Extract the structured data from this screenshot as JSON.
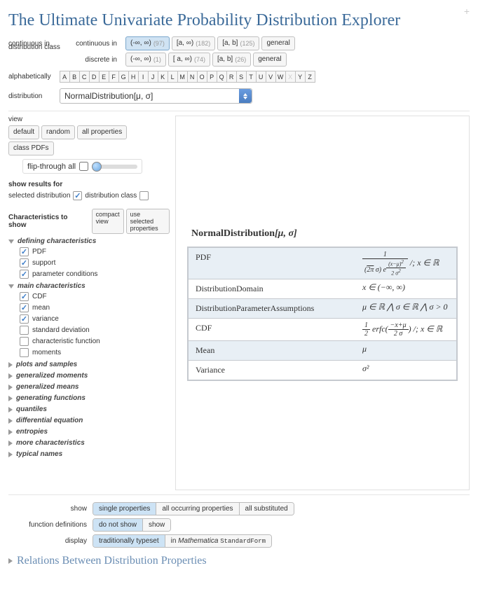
{
  "title": "The Ultimate Univariate Probability Distribution Explorer",
  "plus_icon": "+",
  "distribution_class_label": "distribution class",
  "continuous_label": "continuous in",
  "discrete_label": "discrete in",
  "continuous_ranges": [
    {
      "label": "(-∞, ∞)",
      "count": "(97)",
      "selected": true
    },
    {
      "label": "[a, ∞)",
      "count": "(182)",
      "selected": false
    },
    {
      "label": "[a, b]",
      "count": "(125)",
      "selected": false
    },
    {
      "label": "general",
      "count": "",
      "selected": false
    }
  ],
  "discrete_ranges": [
    {
      "label": "(-∞, ∞)",
      "count": "(1)",
      "selected": false
    },
    {
      "label": "[ a, ∞)",
      "count": "(74)",
      "selected": false
    },
    {
      "label": "[a, b]",
      "count": "(26)",
      "selected": false
    },
    {
      "label": "general",
      "count": "",
      "selected": false
    }
  ],
  "alphabetically_label": "alphabetically",
  "alphabet": [
    "A",
    "B",
    "C",
    "D",
    "E",
    "F",
    "G",
    "H",
    "I",
    "J",
    "K",
    "L",
    "M",
    "N",
    "O",
    "P",
    "Q",
    "R",
    "S",
    "T",
    "U",
    "V",
    "W",
    "X",
    "Y",
    "Z"
  ],
  "alphabet_disabled": [
    "X"
  ],
  "distribution_label": "distribution",
  "distribution_selected": "NormalDistribution[μ, σ]",
  "view_label": "view",
  "view_options": [
    "default",
    "random",
    "all properties",
    "class PDFs"
  ],
  "flip_label": "flip-through all",
  "show_results_for": "show results for",
  "selected_distribution_label": "selected distribution",
  "distribution_class_check_label": "distribution class",
  "characteristics_label": "Characteristics to show",
  "char_buttons": {
    "compact": "compact\nview",
    "use_selected": "use selected\nproperties"
  },
  "categories": [
    {
      "name": "defining characteristics",
      "open": true,
      "items": [
        {
          "label": "PDF",
          "checked": true
        },
        {
          "label": "support",
          "checked": true
        },
        {
          "label": "parameter conditions",
          "checked": true
        }
      ]
    },
    {
      "name": "main characteristics",
      "open": true,
      "items": [
        {
          "label": "CDF",
          "checked": true
        },
        {
          "label": "mean",
          "checked": true
        },
        {
          "label": "variance",
          "checked": true
        },
        {
          "label": "standard deviation",
          "checked": false
        },
        {
          "label": "characteristic function",
          "checked": false
        },
        {
          "label": "moments",
          "checked": false
        }
      ]
    },
    {
      "name": "plots and samples",
      "open": false
    },
    {
      "name": "generalized moments",
      "open": false
    },
    {
      "name": "generalized means",
      "open": false
    },
    {
      "name": "generating functions",
      "open": false
    },
    {
      "name": "quantiles",
      "open": false
    },
    {
      "name": "differential equation",
      "open": false
    },
    {
      "name": "entropies",
      "open": false
    },
    {
      "name": "more characteristics",
      "open": false
    },
    {
      "name": "typical names",
      "open": false
    }
  ],
  "result": {
    "title_dist": "NormalDistribution",
    "title_params": "[μ, σ]",
    "rows": [
      {
        "label": "PDF",
        "highlight": true,
        "value_html": "pdf"
      },
      {
        "label": "DistributionDomain",
        "highlight": false,
        "value": "x ∈ (−∞, ∞)"
      },
      {
        "label": "DistributionParameterAssumptions",
        "highlight": true,
        "value": "μ ∈ ℝ ⋀ σ ∈ ℝ ⋀ σ > 0"
      },
      {
        "label": "CDF",
        "highlight": false,
        "value_html": "cdf"
      },
      {
        "label": "Mean",
        "highlight": true,
        "value": "μ"
      },
      {
        "label": "Variance",
        "highlight": false,
        "value": "σ²"
      }
    ]
  },
  "bottom": {
    "show_label": "show",
    "show_options": [
      "single properties",
      "all occurring properties",
      "all substituted"
    ],
    "show_selected": 0,
    "fdef_label": "function definitions",
    "fdef_options": [
      "do not show",
      "show"
    ],
    "fdef_selected": 0,
    "display_label": "display",
    "display_options_html": [
      "traditionally typeset",
      "in <span class='ital'>Mathematica</span> <span class='mono'>StandardForm</span>"
    ],
    "display_selected": 0
  },
  "relations_title": "Relations Between Distribution Properties"
}
